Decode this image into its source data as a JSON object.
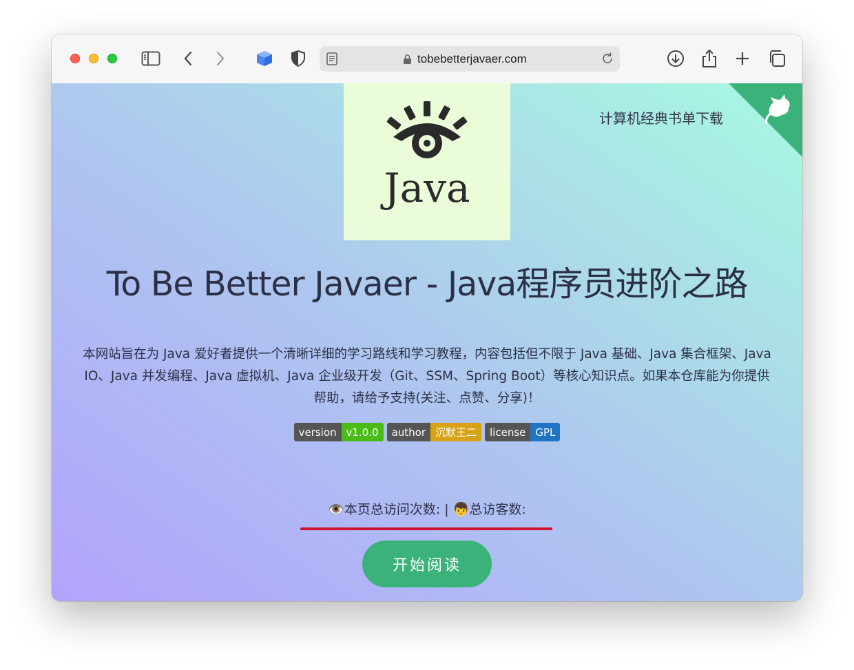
{
  "browser": {
    "url": "tobebetterjavaer.com",
    "icons": [
      "sidebar-icon",
      "back-icon",
      "forward-icon",
      "extension-cube-icon",
      "shield-icon",
      "reader-icon",
      "lock-icon",
      "reload-icon",
      "download-icon",
      "share-icon",
      "new-tab-icon",
      "tabs-overview-icon"
    ]
  },
  "page": {
    "corner_link": "计算机经典书单下载",
    "logo_text": "Java",
    "title": "To Be Better Javaer - Java程序员进阶之路",
    "description": "本网站旨在为 Java 爱好者提供一个清晰详细的学习路线和学习教程，内容包括但不限于 Java 基础、Java 集合框架、Java IO、Java 并发编程、Java 虚拟机、Java 企业级开发（Git、SSM、Spring Boot）等核心知识点。如果本仓库能为你提供帮助，请给予支持(关注、点赞、分享)！",
    "badges": [
      {
        "key": "version",
        "value": "v1.0.0",
        "color": "#4bbb18"
      },
      {
        "key": "author",
        "value": "沉默王二",
        "color": "#d7a216"
      },
      {
        "key": "license",
        "value": "GPL",
        "color": "#1f74c3"
      }
    ],
    "stats": {
      "page_views_icon": "👁️",
      "page_views_label": "本页总访问次数:",
      "separator": "|",
      "visitors_icon": "👦",
      "visitors_label": "总访客数:"
    },
    "start_button": "开始阅读"
  },
  "colors": {
    "accent": "#3bb27a",
    "underline": "#cf1230",
    "logo_bg": "#eafdd8"
  }
}
